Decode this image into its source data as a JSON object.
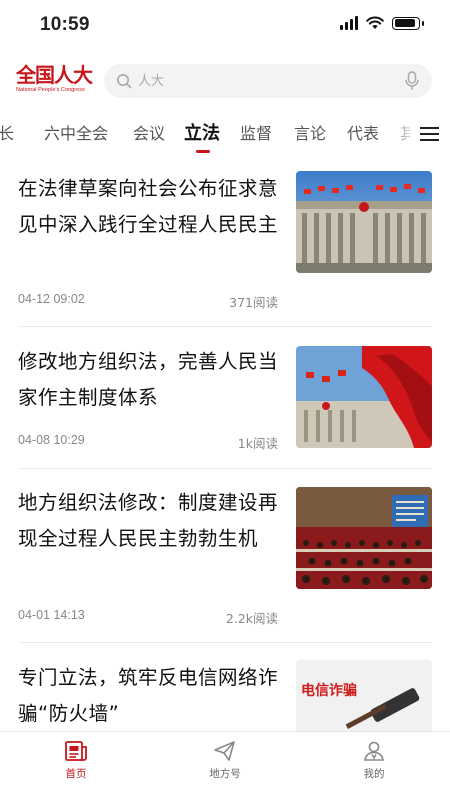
{
  "status": {
    "time": "10:59"
  },
  "header": {
    "logo_text": "全国人大",
    "logo_sub": "National People's Congress",
    "search_placeholder": "人大"
  },
  "tabs": [
    "长",
    "六中全会",
    "会议",
    "立法",
    "监督",
    "言论",
    "代表",
    "其"
  ],
  "active_tab": "立法",
  "articles": [
    {
      "title": "在法律草案向社会公布征求意见中深入践行全过程人民民主",
      "date": "04-12 09:02",
      "reads": "371阅读",
      "image": "building-with-flags"
    },
    {
      "title": "修改地方组织法，完善人民当家作主制度体系",
      "date": "04-08 10:29",
      "reads": "1k阅读",
      "image": "red-flags-great-hall"
    },
    {
      "title": "地方组织法修改：制度建设再现全过程人民民主勃勃生机",
      "date": "04-01 14:13",
      "reads": "2.2k阅读",
      "image": "assembly-hall"
    },
    {
      "title": "专门立法，筑牢反电信网络诈骗“防火墙”",
      "image": "gavel",
      "image_text": "电信诈骗"
    }
  ],
  "bottom_nav": [
    {
      "label": "首页",
      "icon": "newspaper-icon",
      "active": true
    },
    {
      "label": "地方号",
      "icon": "paper-plane-icon",
      "active": false
    },
    {
      "label": "我的",
      "icon": "user-icon",
      "active": false
    }
  ],
  "colors": {
    "accent": "#c8161d",
    "text": "#111111",
    "meta": "#888888"
  }
}
